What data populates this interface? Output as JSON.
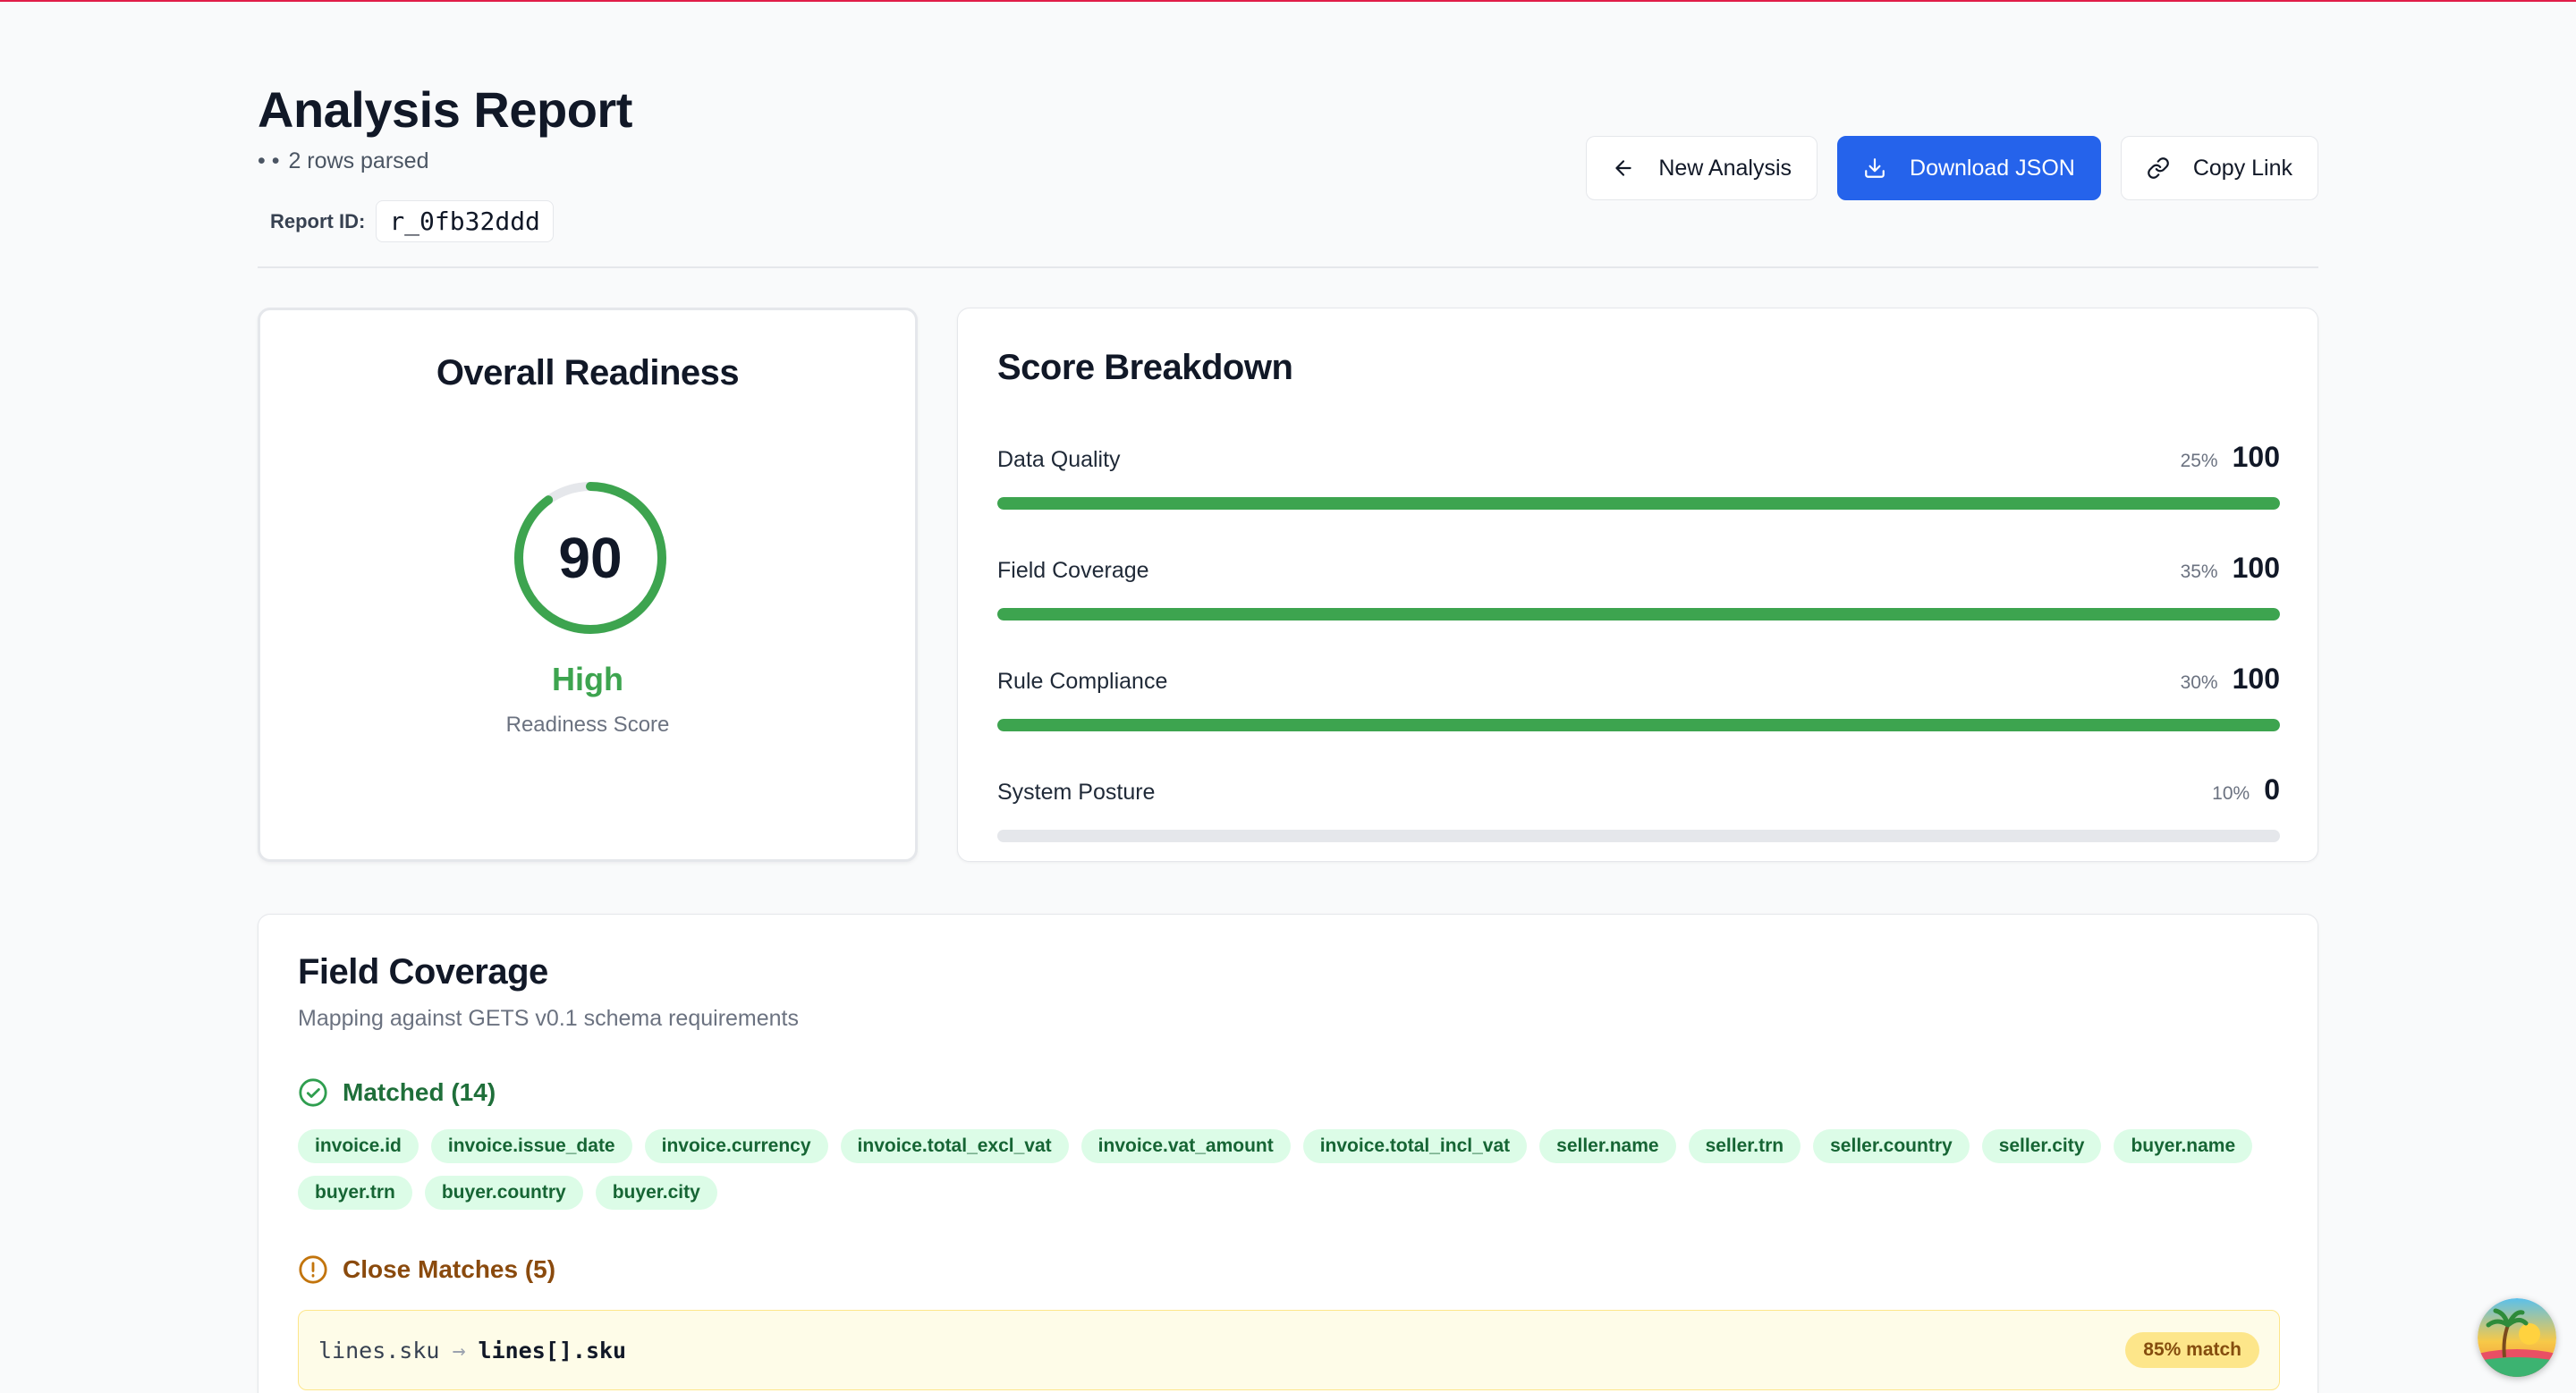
{
  "header": {
    "title": "Analysis Report",
    "subline": "2 rows parsed",
    "report_id_label": "Report ID:",
    "report_id": "r_0fb32ddd"
  },
  "actions": {
    "new_analysis": "New Analysis",
    "download_json": "Download JSON",
    "copy_link": "Copy Link"
  },
  "readiness": {
    "title": "Overall Readiness",
    "score": "90",
    "score_fraction": 0.9,
    "level": "High",
    "subtitle": "Readiness Score",
    "accent_color": "#3da44f"
  },
  "breakdown": {
    "title": "Score Breakdown",
    "metrics": [
      {
        "name": "Data Quality",
        "weight": "25%",
        "score": "100",
        "fraction": 1.0
      },
      {
        "name": "Field Coverage",
        "weight": "35%",
        "score": "100",
        "fraction": 1.0
      },
      {
        "name": "Rule Compliance",
        "weight": "30%",
        "score": "100",
        "fraction": 1.0
      },
      {
        "name": "System Posture",
        "weight": "10%",
        "score": "0",
        "fraction": 0.0
      }
    ]
  },
  "coverage": {
    "title": "Field Coverage",
    "subtitle": "Mapping against GETS v0.1 schema requirements",
    "matched_label": "Matched (14)",
    "matched": [
      "invoice.id",
      "invoice.issue_date",
      "invoice.currency",
      "invoice.total_excl_vat",
      "invoice.vat_amount",
      "invoice.total_incl_vat",
      "seller.name",
      "seller.trn",
      "seller.country",
      "seller.city",
      "buyer.name",
      "buyer.trn",
      "buyer.country",
      "buyer.city"
    ],
    "close_label": "Close Matches (5)",
    "close_matches": [
      {
        "source": "lines.sku",
        "arrow": "→",
        "target": "lines[].sku",
        "match": "85% match"
      }
    ]
  }
}
